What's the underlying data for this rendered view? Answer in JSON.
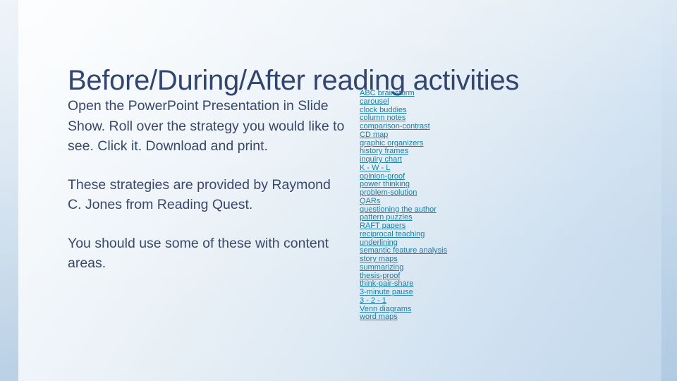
{
  "slide": {
    "title": "Before/During/After reading activities",
    "colors": {
      "title": "#32456e",
      "body_text": "#39486b",
      "link": "#1d7fa6",
      "background_light": "#fbfcfe",
      "background_dark": "#c2d8ea"
    }
  },
  "body": {
    "paragraphs": [
      "Open the PowerPoint Presentation in Slide Show.  Roll over the strategy you would like to see.  Click it.  Download and print.",
      "These strategies are provided by Raymond C. Jones from Reading Quest.",
      "You should use some of these with content areas."
    ]
  },
  "strategy_links": [
    "ABC brainstorm",
    "carousel",
    "clock buddies",
    "column notes",
    "comparison-contrast",
    "CD map",
    "graphic organizers",
    "history frames",
    "inquiry chart",
    "K - W - L",
    "opinion-proof",
    "power thinking",
    "problem-solution",
    "QARs",
    "questioning the author",
    "pattern puzzles",
    "RAFT papers",
    "reciprocal teaching",
    "underlining",
    "semantic feature analysis",
    "story maps",
    "summarizing",
    "thesis-proof",
    "think-pair-share",
    "3-minute pause",
    "3 - 2 - 1",
    "Venn diagrams",
    "word maps"
  ]
}
